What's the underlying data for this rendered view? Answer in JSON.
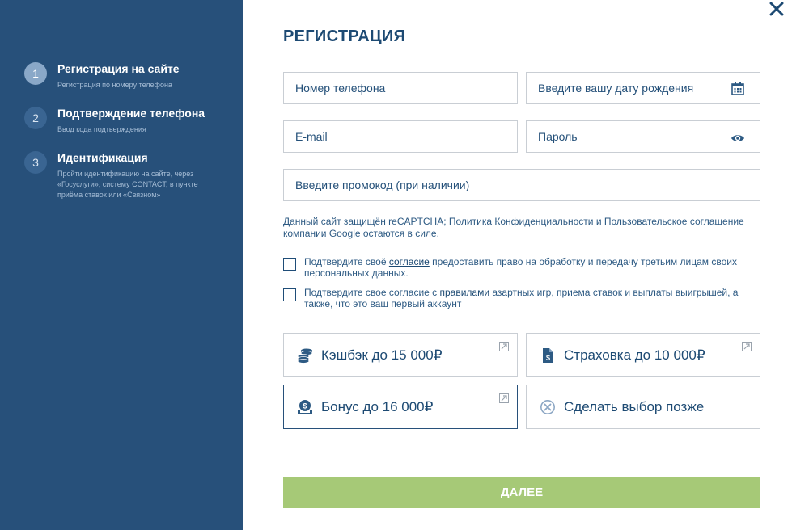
{
  "steps": [
    {
      "num": "1",
      "title": "Регистрация на сайте",
      "desc": "Регистрация по номеру телефона"
    },
    {
      "num": "2",
      "title": "Подтверждение телефона",
      "desc": "Ввод кода подтверждения"
    },
    {
      "num": "3",
      "title": "Идентификация",
      "desc": "Пройти идентификацию на сайте, через «Госуслуги», систему CONTACT, в пункте приёма ставок или «Связном»"
    }
  ],
  "form": {
    "title": "РЕГИСТРАЦИЯ",
    "phone_placeholder": "Номер телефона",
    "birth_placeholder": "Введите вашу дату рождения",
    "email_placeholder": "E-mail",
    "password_placeholder": "Пароль",
    "promo_placeholder": "Введите промокод (при наличии)"
  },
  "captcha": {
    "prefix": "Данный сайт защищён reCAPTCHA; ",
    "link": "Политика Конфиденциальности и Пользовательское соглашение",
    "suffix": " компании Google остаются в силе."
  },
  "consents": [
    {
      "before": "Подтвердите своё ",
      "link": "согласие",
      "after": " предоставить право на обработку и передачу третьим лицам своих персональных данных."
    },
    {
      "before": "Подтвердите свое согласие с ",
      "link": "правилами",
      "after": " азартных игр, приема ставок и выплаты выигрышей, а также, что это ваш первый аккаунт"
    }
  ],
  "bonuses": [
    {
      "label": "Кэшбэк до 15 000₽",
      "icon": "coins-icon"
    },
    {
      "label": "Страховка до 10 000₽",
      "icon": "document-dollar-icon"
    },
    {
      "label": "Бонус до 16 000₽",
      "icon": "money-bag-icon",
      "selected": true
    },
    {
      "label": "Сделать выбор позже",
      "icon": "cancel-circle-icon"
    }
  ],
  "next_label": "ДАЛЕЕ",
  "colors": {
    "sidebar": "#27507a",
    "primary_text": "#1d4a73",
    "next_button": "#a6c977"
  }
}
